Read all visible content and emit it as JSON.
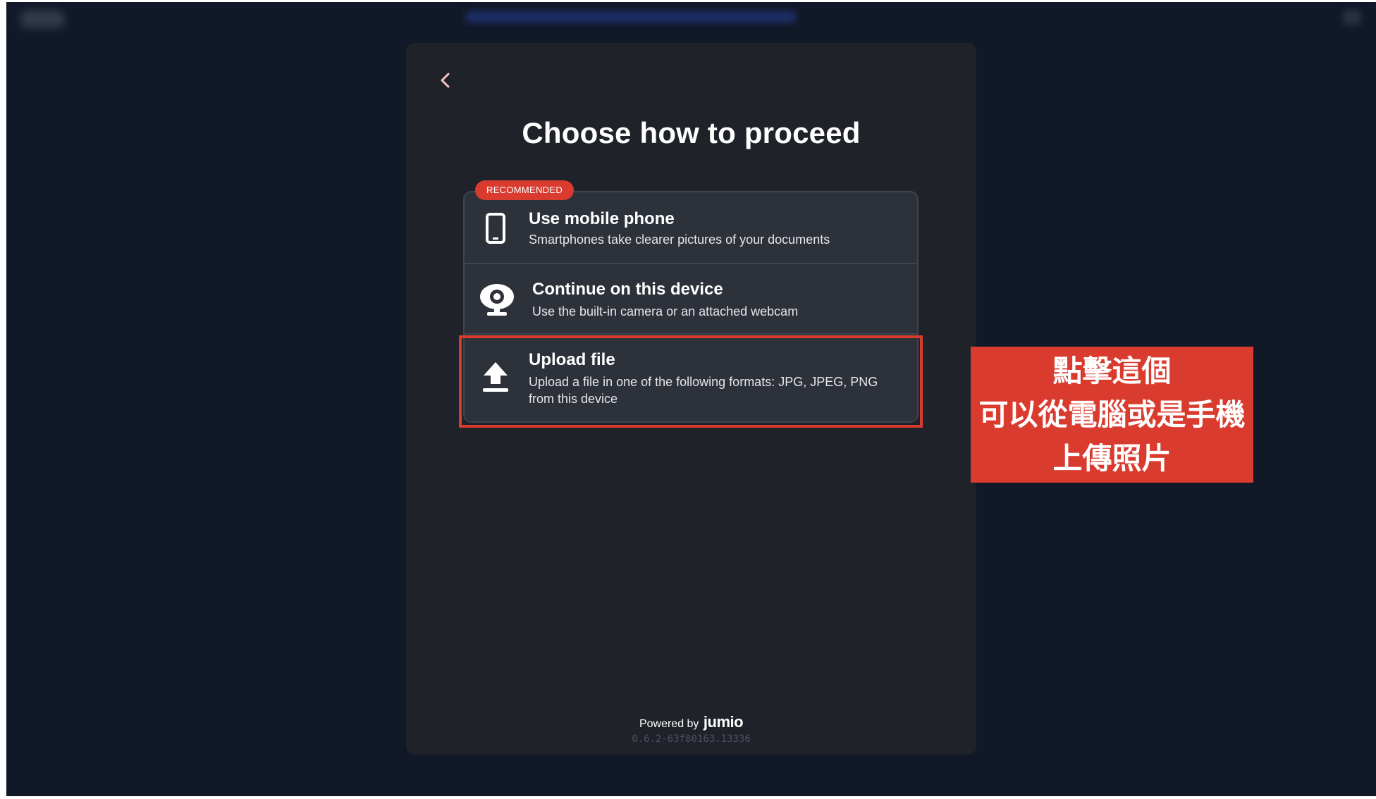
{
  "header": {
    "title": "Choose how to proceed",
    "back_icon": "chevron-left-icon"
  },
  "options": [
    {
      "badge": "RECOMMENDED",
      "icon": "mobile-phone-icon",
      "title": "Use mobile phone",
      "description": "Smartphones take clearer pictures of your documents"
    },
    {
      "icon": "webcam-icon",
      "title": "Continue on this device",
      "description": "Use the built-in camera or an attached webcam"
    },
    {
      "icon": "upload-icon",
      "title": "Upload file",
      "description": "Upload a file in one of the following formats: JPG, JPEG, PNG from this device",
      "highlighted": true
    }
  ],
  "annotation": {
    "lines": [
      "點擊這個",
      "可以從電腦或是手機",
      "上傳照片"
    ],
    "color": "#d93c2f"
  },
  "footer": {
    "powered_by": "Powered by",
    "brand": "jumio",
    "version": "0.6.2-63f80163.13336"
  },
  "colors": {
    "page_bg": "#111827",
    "panel_bg": "#1f2329",
    "accent_red": "#d93c2f"
  }
}
